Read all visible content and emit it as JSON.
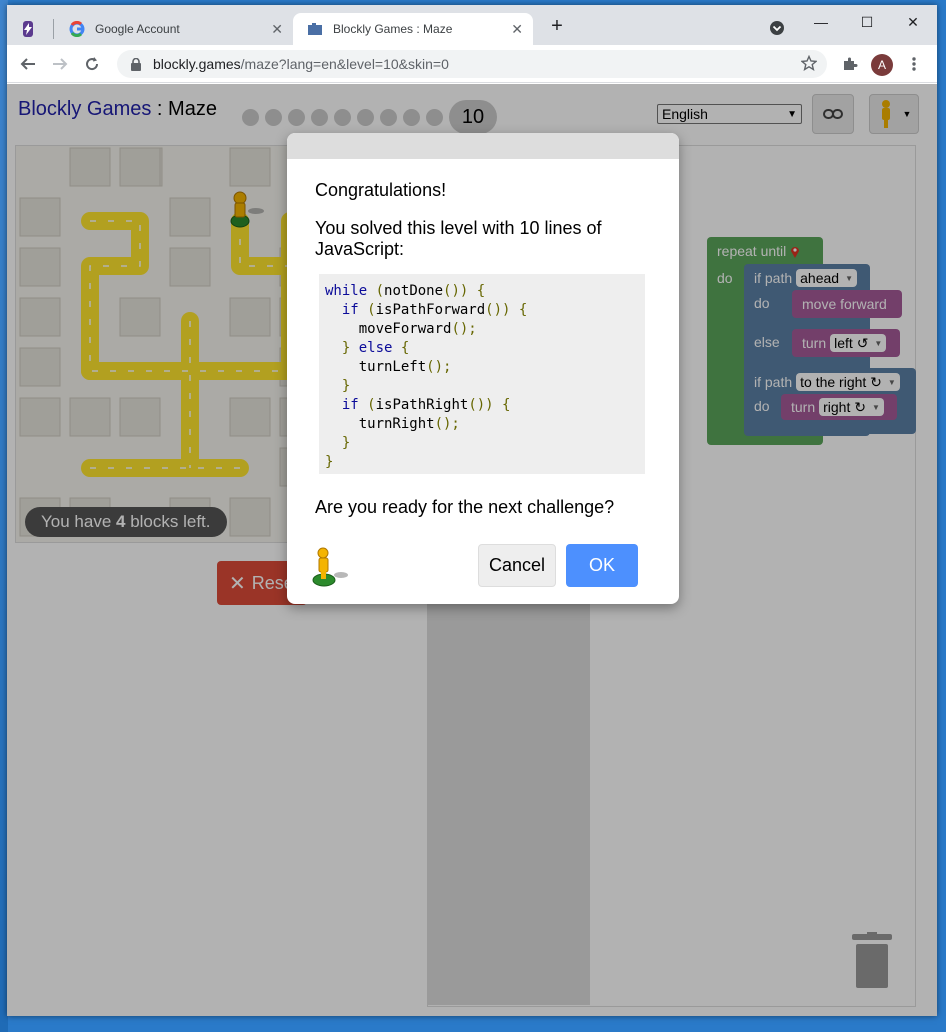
{
  "browser": {
    "tabs": [
      {
        "label": "Google Account",
        "icon": "google-icon"
      },
      {
        "label": "Blockly Games : Maze",
        "icon": "blockly-puzzle-icon"
      }
    ],
    "url_host": "blockly.games",
    "url_path": "/maze?lang=en&level=10&skin=0",
    "avatar_letter": "A"
  },
  "app": {
    "brand": "Blockly Games",
    "separator": " : ",
    "title": "Maze",
    "current_level": "10",
    "total_levels": 10,
    "language": "English",
    "blocks_left_prefix": "You have ",
    "blocks_left_count": "4",
    "blocks_left_suffix": " blocks left.",
    "reset_label": "Reset"
  },
  "program": {
    "repeat_label": "repeat until",
    "do_label": "do",
    "else_label": "else",
    "if_path_label": "if path",
    "ahead_option": "ahead",
    "move_forward_label": "move forward",
    "turn_label": "turn",
    "left_option": "left ↺",
    "right_option": "right ↻",
    "to_the_right_option": "to the right ↻"
  },
  "dialog": {
    "title": "Congratulations!",
    "message": "You solved this level with 10 lines of JavaScript:",
    "code_lines": [
      "while (notDone()) {",
      "  if (isPathForward()) {",
      "    moveForward();",
      "  } else {",
      "    turnLeft();",
      "  }",
      "  if (isPathRight()) {",
      "    turnRight();",
      "  }",
      "}"
    ],
    "question": "Are you ready for the next challenge?",
    "cancel_label": "Cancel",
    "ok_label": "OK"
  },
  "colors": {
    "loop_block": "#5ba55b",
    "logic_block": "#5b80a5",
    "action_block": "#a55b99",
    "ok_button": "#4d90fe",
    "reset_button": "#dd4b39",
    "maze_path": "#ffe62e"
  }
}
